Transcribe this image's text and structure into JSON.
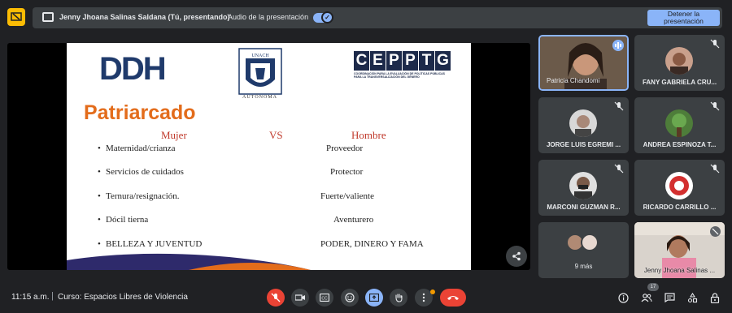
{
  "topbar": {
    "presenter_label": "Jenny Jhoana Salinas Saldana (Tú, presentando)",
    "audio_label": "Audio de la presentación",
    "audio_on": true,
    "stop_button": "Detener la presentación",
    "accent": "#8ab4f8"
  },
  "slide": {
    "ddh_logo": "DDH",
    "unach_logo_text": "UNACH",
    "unach_caption": "AUTÓNOMA",
    "ceptg_letters": [
      "C",
      "E",
      "P",
      "P",
      "T",
      "G"
    ],
    "ceptg_sub": "COORDINACIÓN PARA LA EVALUACIÓN DE POLÍTICAS PÚBLICAS PARA LA TRANSVERSALIZACIÓN DEL GÉNERO",
    "title": "Patriarcado",
    "col_left": "Mujer",
    "col_vs": "VS",
    "col_right": "Hombre",
    "left_items": [
      "Maternidad/crianza",
      "Servicios de cuidados",
      "Ternura/resignación.",
      "Dócil tierna",
      "BELLEZA Y JUVENTUD"
    ],
    "right_items": [
      "Proveedor",
      "Protector",
      "Fuerte/valiente",
      "Aventurero",
      "PODER, DINERO Y FAMA"
    ]
  },
  "participants": [
    {
      "name": "Patricia Chandomi",
      "muted": false,
      "speaking": true
    },
    {
      "name": "FANY GABRIELA CRU...",
      "muted": true
    },
    {
      "name": "JORGE LUIS EGREMI ...",
      "muted": true
    },
    {
      "name": "ANDREA ESPINOZA T...",
      "muted": true
    },
    {
      "name": "MARCONI GUZMAN R...",
      "muted": true
    },
    {
      "name": "RICARDO CARRILLO ...",
      "muted": true
    },
    {
      "name": "9 más"
    },
    {
      "name": "Jenny Jhoana Salinas ...",
      "muted": true
    }
  ],
  "bottombar": {
    "time": "11:15 a.m.",
    "separator": "|",
    "meeting": "Curso: Espacios Libres de Violencia",
    "participant_count": "17",
    "end_call_color": "#ea4335",
    "present_color": "#8ab4f8"
  },
  "icons": {
    "present_status": "present-to-all-icon",
    "share": "share-icon",
    "mic": "mic-off-icon",
    "camera": "camera-icon",
    "captions": "captions-icon",
    "emoji": "emoji-icon",
    "present": "present-icon",
    "hand": "hand-icon",
    "more": "more-vert-icon",
    "end": "call-end-icon",
    "info": "info-icon",
    "people": "people-icon",
    "chat": "chat-icon",
    "activities": "activities-icon",
    "lock": "host-controls-icon"
  }
}
